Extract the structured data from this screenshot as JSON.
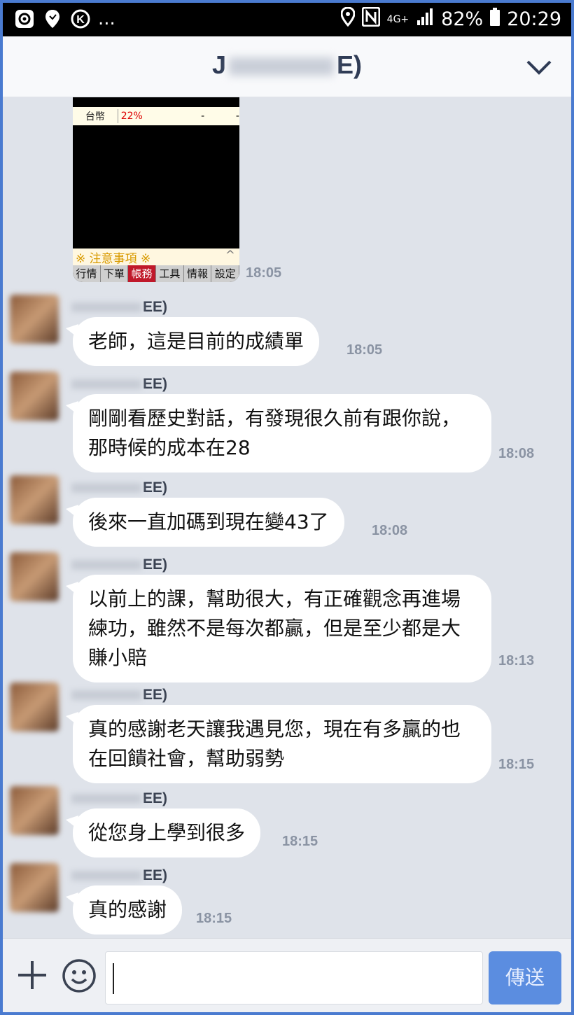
{
  "status_bar": {
    "left_icons": [
      "at-icon",
      "location-icon",
      "k-icon"
    ],
    "ellipsis": "...",
    "network": "4G+",
    "battery": "82%",
    "time": "20:29"
  },
  "header": {
    "title_start": "J",
    "title_end": "E)",
    "chevron": "chevron-down-icon"
  },
  "image_message": {
    "row_label": "台幣",
    "row_value": "22%",
    "dash": "-",
    "notice": "※ 注意事項 ※",
    "tabs": [
      "行情",
      "下單",
      "帳務",
      "工具",
      "情報",
      "設定"
    ],
    "active_tab": "帳務",
    "time": "18:05"
  },
  "messages": [
    {
      "sender_suffix": "EE)",
      "text": "老師，這是目前的成績單",
      "time": "18:05"
    },
    {
      "sender_suffix": "EE)",
      "text": "剛剛看歷史對話，有發現很久前有跟你說，那時候的成本在28",
      "time": "18:08"
    },
    {
      "sender_suffix": "EE)",
      "text": "後來一直加碼到現在變43了",
      "time": "18:08"
    },
    {
      "sender_suffix": "EE)",
      "text": "以前上的課，幫助很大，有正確觀念再進場練功，雖然不是每次都贏，但是至少都是大賺小賠",
      "time": "18:13"
    },
    {
      "sender_suffix": "EE)",
      "text": "真的感謝老天讓我遇見您，現在有多贏的也在回饋社會，幫助弱勢",
      "time": "18:15"
    },
    {
      "sender_suffix": "EE)",
      "text": "從您身上學到很多",
      "time": "18:15"
    },
    {
      "sender_suffix": "EE)",
      "text": "真的感謝",
      "time": "18:15"
    }
  ],
  "input_bar": {
    "send_label": "傳送",
    "text_value": ""
  },
  "colors": {
    "frame": "#4a7bd0",
    "chat_bg": "#dfe3ea",
    "send_button": "#5b8de0"
  }
}
